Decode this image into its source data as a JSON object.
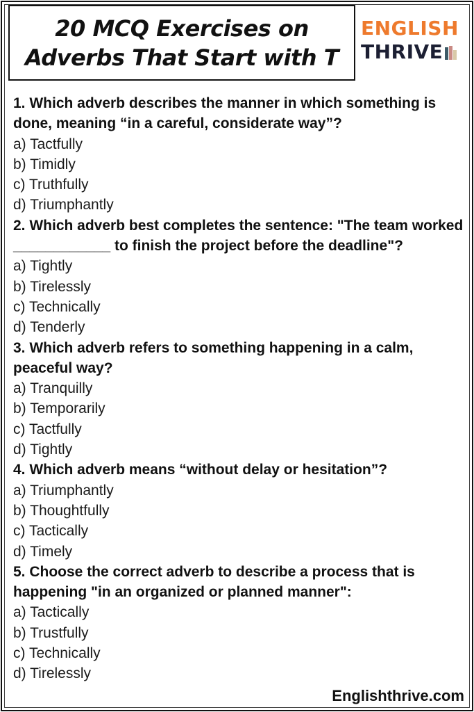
{
  "header": {
    "title_line1": "20 MCQ Exercises on",
    "title_line2": "Adverbs That Start with T"
  },
  "logo": {
    "top": "ENGLISH",
    "bottom": "THRIVE",
    "icon": "books-icon",
    "colors": {
      "top": "#ee7a2d",
      "bottom": "#1c1f33"
    }
  },
  "questions": [
    {
      "text": "1. Which adverb describes the manner in which something is done, meaning “in a careful, considerate way”?",
      "options": [
        "a) Tactfully",
        "b) Timidly",
        "c) Truthfully",
        "d) Triumphantly"
      ]
    },
    {
      "text": "2. Which adverb best completes the sentence: \"The team worked ____________ to finish the project before the deadline\"?",
      "options": [
        "a) Tightly",
        "b) Tirelessly",
        "c) Technically",
        "d) Tenderly"
      ]
    },
    {
      "text": "3. Which adverb refers to something happening in a calm, peaceful way?",
      "options": [
        "a) Tranquilly",
        "b) Temporarily",
        "c) Tactfully",
        "d) Tightly"
      ]
    },
    {
      "text": "4. Which adverb means “without delay or hesitation”?",
      "options": [
        "a) Triumphantly",
        "b) Thoughtfully",
        "c) Tactically",
        "d) Timely"
      ]
    },
    {
      "text": "5. Choose the correct adverb to describe a process that is happening \"in an organized or planned manner\":",
      "options": [
        "a) Tactically",
        "b) Trustfully",
        "c) Technically",
        "d) Tirelessly"
      ]
    }
  ],
  "footer": {
    "site": "Englishthrive.com"
  }
}
